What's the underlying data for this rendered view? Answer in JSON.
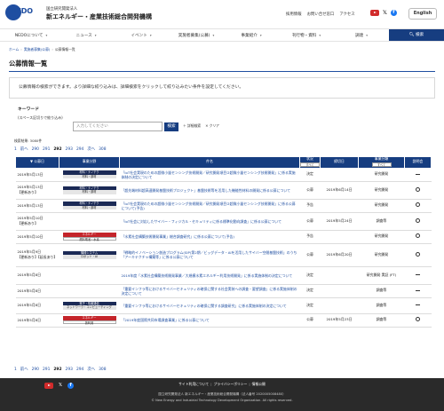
{
  "header": {
    "logo_text": "NEDO",
    "org_sub": "国立研究開発法人",
    "org_name": "新エネルギー・産業技術総合開発機構",
    "links": [
      "採用情報",
      "お問い合せ窓口",
      "アクセス"
    ],
    "english_button": "English"
  },
  "nav": {
    "items": [
      "NEDOについて",
      "ニュース",
      "イベント",
      "実施者募集(公募)",
      "事業紹介",
      "刊行物・資料",
      "調達"
    ],
    "search_label": "検索"
  },
  "breadcrumb": [
    "ホーム",
    "実施者募集(公募)",
    "公募情報一覧"
  ],
  "page_title": "公募情報一覧",
  "description": "公募情報の検索ができます。より詳細な絞り込みは、詳細検索をクリックして絞り込みたい条件を設定してください。",
  "search": {
    "keyword_label": "キーワード",
    "keyword_sub": "(スペース区切りで絞り込み)",
    "placeholder": "入力してください",
    "button": "検索",
    "advanced": "詳細検索",
    "clear": "クリア"
  },
  "count_text": "検索結果: 3080件",
  "pager": {
    "first": "1",
    "prev": "前へ",
    "pages": [
      "290",
      "291",
      "292",
      "293",
      "294"
    ],
    "current": "292",
    "next": "次へ",
    "last": "308"
  },
  "table": {
    "headers": {
      "date": "公募日",
      "category": "事業分野",
      "title": "件名",
      "status": "状況",
      "status_select": "すべて",
      "deadline": "締切日",
      "type": "事業分類",
      "type_select": "すべて",
      "meeting": "説明会"
    },
    "rows": [
      {
        "date": "2019年5月13日",
        "update": "",
        "tags": [
          {
            "label": "材料・ナノテク",
            "style": "b"
          },
          {
            "label": "材料・部材",
            "style": "e"
          }
        ],
        "title": "「IoT社会実現のための超微小量センシング技術開発／研究開発項目②超微小量センシング技術開発」に係る実施体制の決定について",
        "status": "決定",
        "deadline": "",
        "type": "研究開発",
        "meeting": "dash"
      },
      {
        "date": "2019年5月13日",
        "update": "【更新あり】",
        "tags": [
          {
            "label": "材料・ナノテク",
            "style": "b"
          },
          {
            "label": "材料・部材",
            "style": "e"
          }
        ],
        "title": "「超先端材料超高速開発基盤技術プロジェクト」基盤技術等を活用した機能性材料の開発に係る公募について",
        "status": "公募",
        "deadline": "2019年6月14日",
        "type": "研究開発",
        "meeting": "circle"
      },
      {
        "date": "2019年5月13日",
        "update": "",
        "tags": [
          {
            "label": "材料・ナノテク",
            "style": "b"
          },
          {
            "label": "材料・部材",
            "style": "e"
          }
        ],
        "title": "「IoT社会実現のための超微小量センシング技術開発／研究開発項目②超微小量センシング技術開発」に係る公募について(予告)",
        "status": "予告",
        "deadline": "",
        "type": "研究開発",
        "meeting": "circle"
      },
      {
        "date": "2019年5月10日",
        "update": "【更新あり】",
        "tags": [],
        "title": "「IoT社会に対応したサイバー・フィジカル・セキュリティに係る標準化動向調査」に係る公募について",
        "status": "公募",
        "deadline": "2019年5月24日",
        "type": "調査等",
        "meeting": "circle"
      },
      {
        "date": "2019年5月10日",
        "update": "",
        "tags": [
          {
            "label": "エネルギー",
            "style": "a"
          },
          {
            "label": "燃料電池・水素",
            "style": "d"
          }
        ],
        "title": "「水素社会構築技術開発事業」総合調査研究」に係る公募について(予告)",
        "status": "予告",
        "deadline": "",
        "type": "研究開発",
        "meeting": "circle"
      },
      {
        "date": "2019年5月9日",
        "update": "【更新あり】【延長あり】",
        "tags": [
          {
            "label": "機械システム",
            "style": "b"
          },
          {
            "label": "ロボット・AI",
            "style": "e"
          }
        ],
        "title": "「戦略的イノベーション創造プログラム(SIP)第2期／ビッグデータ・AIを活用したサイバー空間基盤技術」のうち「アーキテクチャ構築等」に係る公募について",
        "status": "公募",
        "deadline": "2019年6月20日",
        "type": "研究開発",
        "meeting": "circle"
      },
      {
        "date": "2019年5月8日",
        "update": "",
        "tags": [],
        "title": "2019年度「水素社会構築技術開発事業／大規模水素エネルギー利用技術開発」に係る実施体制の決定について",
        "status": "決定",
        "deadline": "",
        "type": "研究開発 実証 (FT)",
        "meeting": "dash"
      },
      {
        "date": "2019年5月8日",
        "update": "",
        "tags": [],
        "title": "「重要インフラ等におけるサイバーセキュリティの確保に関する社会実装への調査・要望調査」に係る実施体制の決定について",
        "status": "決定",
        "deadline": "",
        "type": "調査等",
        "meeting": "dash"
      },
      {
        "date": "2019年5月8日",
        "update": "",
        "tags": [
          {
            "label": "電子・情報通信",
            "style": "b"
          },
          {
            "label": "ネットワーク・コンピューティング",
            "style": "e"
          }
        ],
        "title": "「重要インフラ等におけるサイバーセキュリティの確保に関する調査研究」に係る実施体制の決定について",
        "status": "決定",
        "deadline": "",
        "type": "調査等",
        "meeting": "dash"
      },
      {
        "date": "2019年5月8日",
        "update": "",
        "tags": [
          {
            "label": "エネルギー",
            "style": "a"
          },
          {
            "label": "熱利用",
            "style": "d"
          }
        ],
        "title": "「2019年度国際共同市場調査事業」に係る公募について",
        "status": "公募",
        "deadline": "2019年5月23日",
        "type": "調査等",
        "meeting": "circle"
      }
    ]
  },
  "footer": {
    "links": [
      "サイト利用について",
      "プライバシーポリシー",
      "情報公開"
    ],
    "org": "国立研究開発法人 新エネルギー・産業技術総合開発機構（法人番号 2020005008480）",
    "copyright": "© New Energy and Industrial Technology Development Organization. All rights reserved."
  }
}
